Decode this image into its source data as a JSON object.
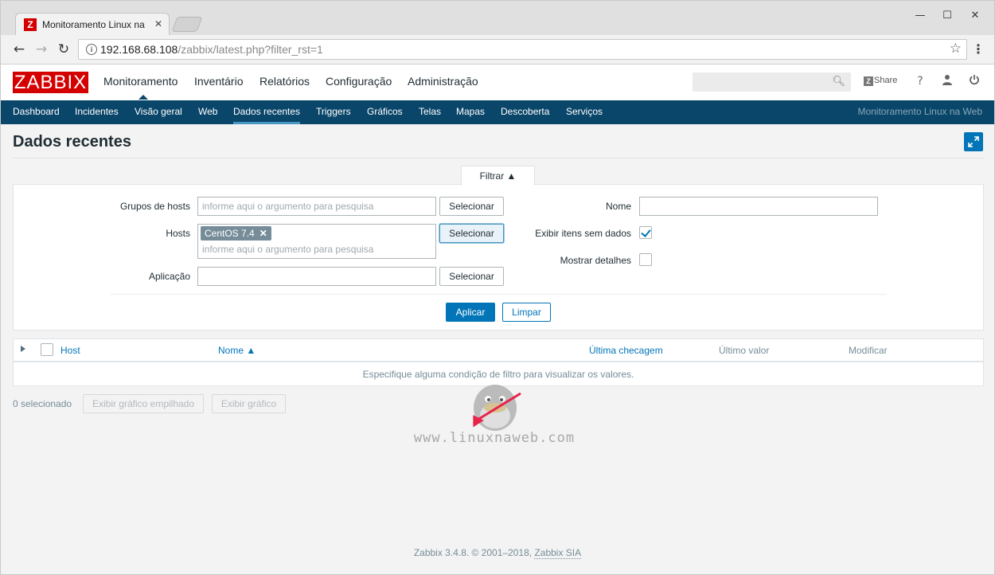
{
  "browser": {
    "tab_title": "Monitoramento Linux na Web",
    "favicon_letter": "Z",
    "url_host": "192.168.68.108",
    "url_path": "/zabbix/latest.php?filter_rst=1",
    "window_controls": {
      "minimize": "—",
      "maximize": "☐",
      "close": "✕"
    }
  },
  "header": {
    "logo": "ZABBIX",
    "nav": [
      "Monitoramento",
      "Inventário",
      "Relatórios",
      "Configuração",
      "Administração"
    ],
    "share_label": "Share",
    "help_label": "?"
  },
  "subnav": {
    "items": [
      "Dashboard",
      "Incidentes",
      "Visão geral",
      "Web",
      "Dados recentes",
      "Triggers",
      "Gráficos",
      "Telas",
      "Mapas",
      "Descoberta",
      "Serviços"
    ],
    "active": "Dados recentes",
    "server_name": "Monitoramento Linux na Web"
  },
  "page": {
    "title": "Dados recentes"
  },
  "filter": {
    "tab_label": "Filtrar ▲",
    "host_groups_label": "Grupos de hosts",
    "host_groups_placeholder": "informe aqui o argumento para pesquisa",
    "hosts_label": "Hosts",
    "hosts_selected": "CentOS 7.4",
    "hosts_placeholder": "informe aqui o argumento para pesquisa",
    "application_label": "Aplicação",
    "application_value": "",
    "select_label": "Selecionar",
    "name_label": "Nome",
    "name_value": "",
    "show_items_without_data_label": "Exibir itens sem dados",
    "show_items_without_data_checked": true,
    "show_details_label": "Mostrar detalhes",
    "show_details_checked": false,
    "apply_label": "Aplicar",
    "reset_label": "Limpar"
  },
  "table": {
    "columns": {
      "host": "Host",
      "name": "Nome ▲",
      "last_check": "Última checagem",
      "last_value": "Último valor",
      "change": "Modificar"
    },
    "empty_message": "Especifique alguma condição de filtro para visualizar os valores."
  },
  "actions": {
    "selected_count": "0 selecionado",
    "stacked_graph_label": "Exibir gráfico empilhado",
    "graph_label": "Exibir gráfico"
  },
  "watermark": {
    "text": "www.linuxnaweb.com"
  },
  "footer": {
    "text": "Zabbix 3.4.8. © 2001–2018, ",
    "link": "Zabbix SIA"
  },
  "colors": {
    "brand_red": "#d40000",
    "nav_blue": "#0a466a",
    "accent_blue": "#0275b8",
    "annotation_arrow": "#e8244a"
  }
}
